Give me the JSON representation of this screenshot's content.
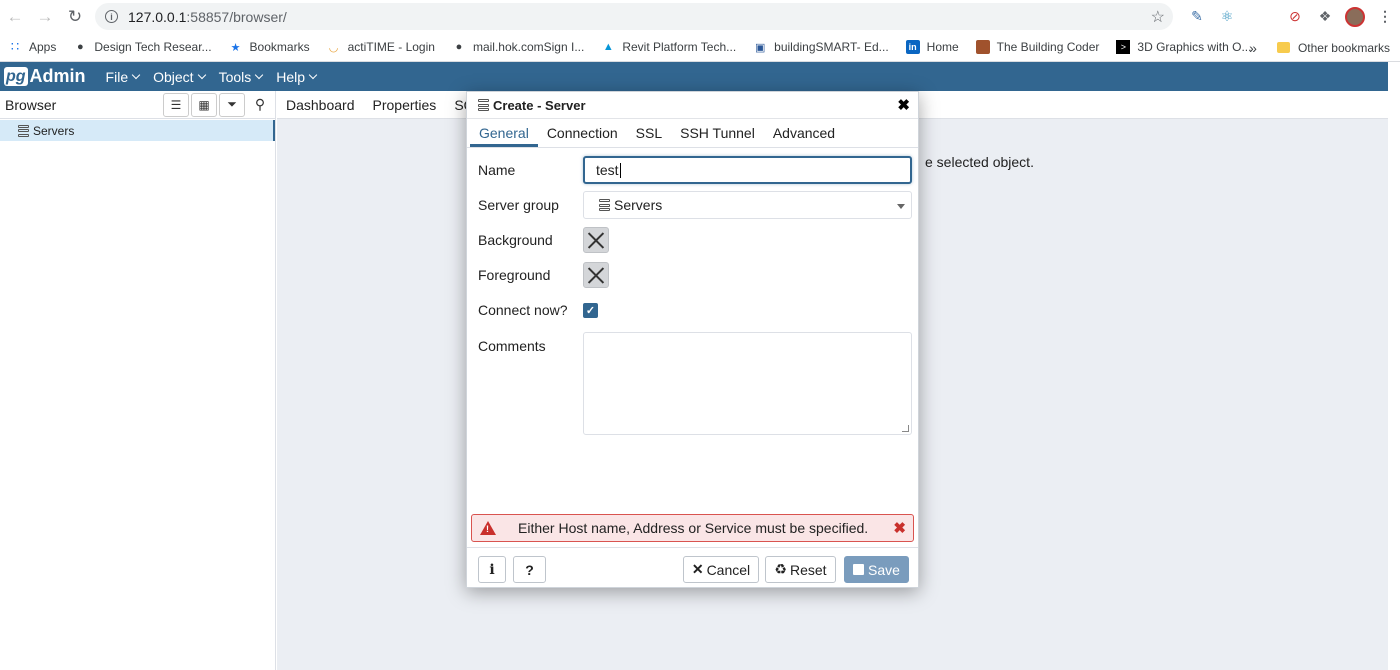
{
  "browser": {
    "url_host": "127.0.0.1",
    "url_rest": ":58857/browser/",
    "bookmarks": [
      {
        "label": "Apps",
        "icon": "apps-grid-icon"
      },
      {
        "label": "Design Tech Resear...",
        "icon": "globe-icon"
      },
      {
        "label": "Bookmarks",
        "icon": "star-icon"
      },
      {
        "label": "actiTIME - Login",
        "icon": "actitime-icon"
      },
      {
        "label": "mail.hok.comSign I...",
        "icon": "globe-icon"
      },
      {
        "label": "Revit Platform Tech...",
        "icon": "autodesk-icon"
      },
      {
        "label": "buildingSMART- Ed...",
        "icon": "buildingsmart-icon"
      },
      {
        "label": "Home",
        "icon": "linkedin-icon"
      },
      {
        "label": "The Building Coder",
        "icon": "avatar-icon"
      },
      {
        "label": "3D Graphics with O...",
        "icon": "terminal-icon"
      }
    ],
    "overflow": "»",
    "other_bookmarks": "Other bookmarks"
  },
  "pgadmin": {
    "logo_pg": "pg",
    "logo_admin": "Admin",
    "menus": [
      "File",
      "Object",
      "Tools",
      "Help"
    ],
    "browser_title": "Browser",
    "tree_item": "Servers",
    "main_tabs": [
      "Dashboard",
      "Properties",
      "SQL"
    ],
    "background_message": "e selected object."
  },
  "dialog": {
    "title": "Create - Server",
    "tabs": [
      "General",
      "Connection",
      "SSL",
      "SSH Tunnel",
      "Advanced"
    ],
    "active_tab": "General",
    "fields": {
      "name_label": "Name",
      "name_value": "test",
      "server_group_label": "Server group",
      "server_group_value": "Servers",
      "background_label": "Background",
      "foreground_label": "Foreground",
      "connect_now_label": "Connect now?",
      "connect_now_checked": true,
      "comments_label": "Comments",
      "comments_value": ""
    },
    "error": "Either Host name, Address or Service must be specified.",
    "buttons": {
      "info": "i",
      "help": "?",
      "cancel": "Cancel",
      "reset": "Reset",
      "save": "Save"
    }
  },
  "colors": {
    "brand": "#326690",
    "error_bg": "#fae5e6",
    "error_border": "#d9534f",
    "save_disabled": "#7a9cbd"
  }
}
